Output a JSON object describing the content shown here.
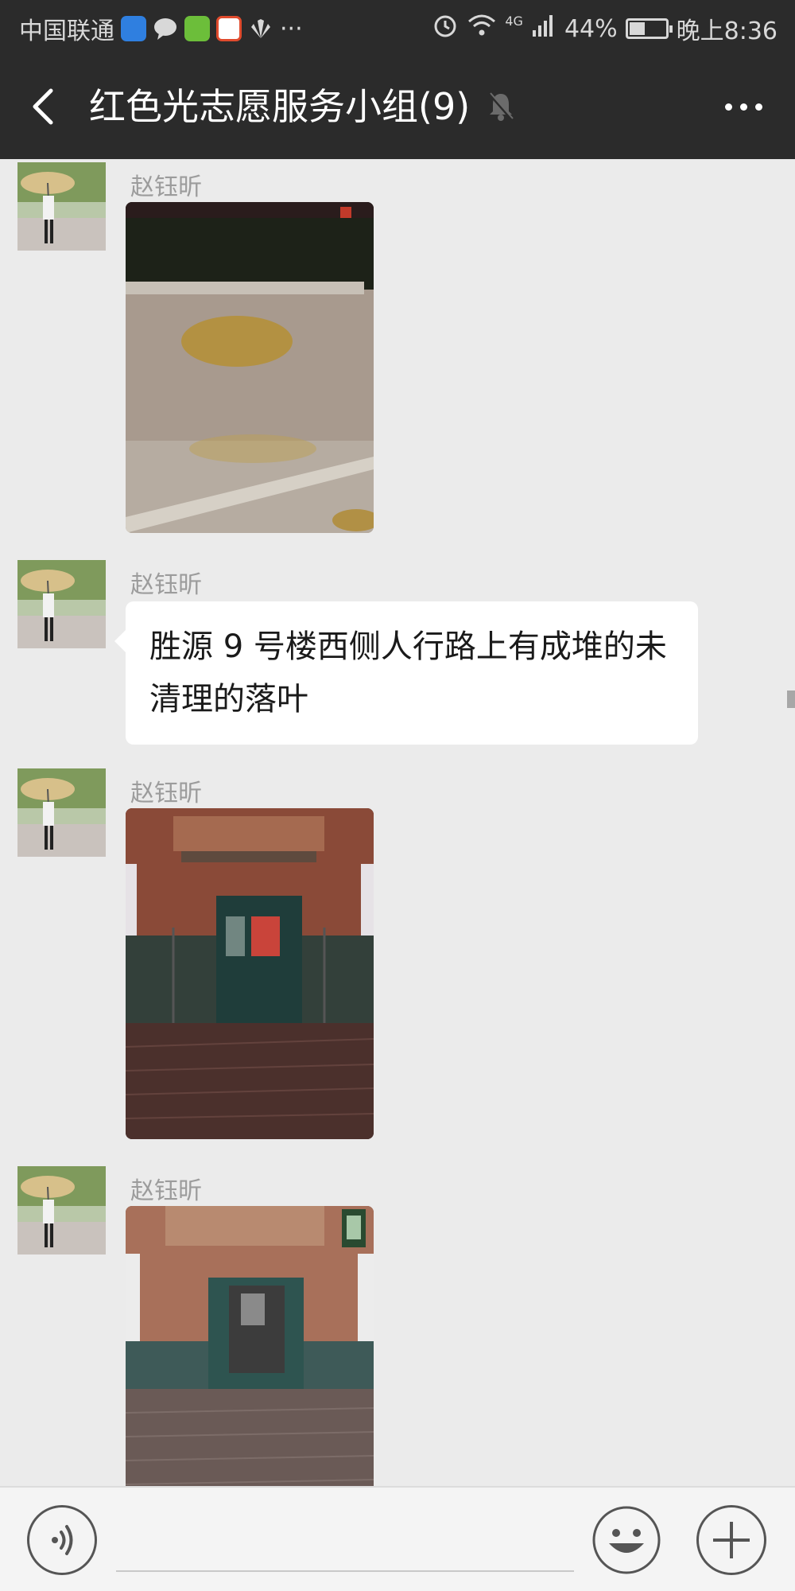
{
  "status_bar": {
    "carrier": "中国联通",
    "dots": "···",
    "network": "4G",
    "battery_percent": "44%",
    "battery_level": 0.44,
    "time": "晚上8:36",
    "app_icons": [
      "shield-icon",
      "chat-bubble-icon",
      "green-app-icon",
      "browser-icon",
      "huawei-icon"
    ]
  },
  "header": {
    "title": "红色光志愿服务小组(9)",
    "muted": true
  },
  "messages": [
    {
      "type": "image",
      "sender": "赵钰昕",
      "image_desc": "night-leaves-pavement"
    },
    {
      "type": "text",
      "sender": "赵钰昕",
      "text": "胜源 9 号楼西侧人行路上有成堆的未清理的落叶"
    },
    {
      "type": "image",
      "sender": "赵钰昕",
      "image_desc": "building-entrance-night"
    },
    {
      "type": "image",
      "sender": "赵钰昕",
      "image_desc": "building-entrance-night-2"
    }
  ],
  "input_bar": {
    "placeholder": ""
  },
  "colors": {
    "header_bg": "#2b2b2b",
    "chat_bg": "#ebebeb",
    "bubble_bg": "#ffffff"
  }
}
